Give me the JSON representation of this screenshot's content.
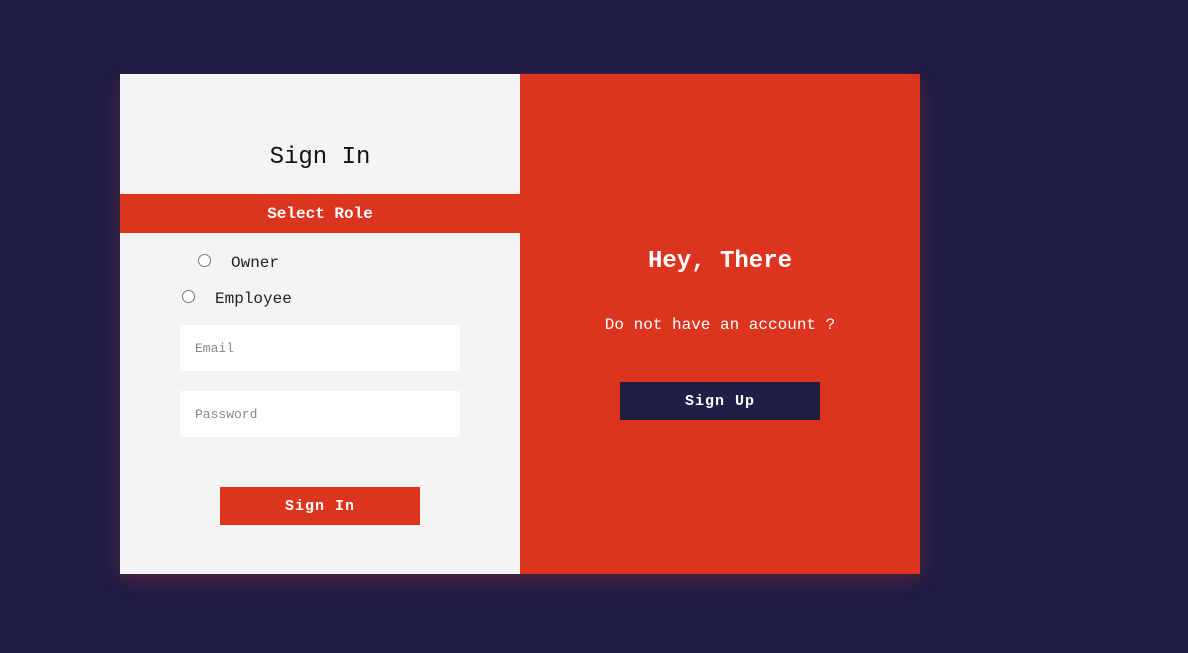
{
  "signin": {
    "title": "Sign In",
    "role_header": "Select Role",
    "roles": [
      {
        "label": "Owner"
      },
      {
        "label": "Employee"
      }
    ],
    "email_placeholder": "Email",
    "password_placeholder": "Password",
    "submit_label": "Sign In"
  },
  "signup_panel": {
    "heading": "Hey, There",
    "prompt": "Do not have an account ?",
    "button_label": "Sign Up"
  },
  "colors": {
    "background": "#201d47",
    "accent": "#dd341f",
    "panel": "#f4f4f4"
  }
}
